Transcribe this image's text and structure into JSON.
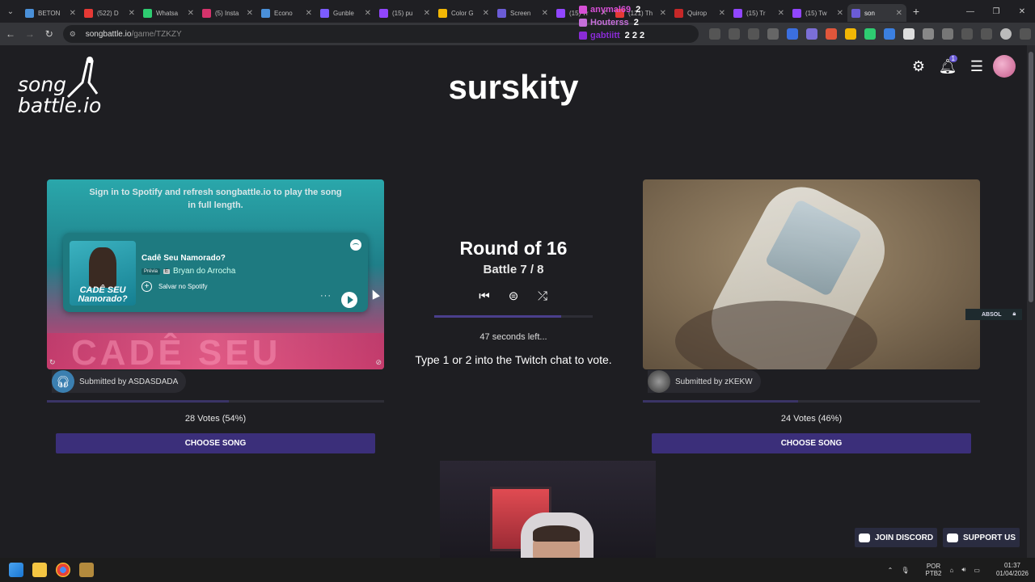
{
  "browser": {
    "tabs": [
      {
        "label": "BETON",
        "color": "#4a90d9"
      },
      {
        "label": "(522) D",
        "color": "#e53935"
      },
      {
        "label": "Whatsa",
        "color": "#2ecc71"
      },
      {
        "label": "(5) Insta",
        "color": "#d6336c"
      },
      {
        "label": "Econo",
        "color": "#4a90d9"
      },
      {
        "label": "Gunble",
        "color": "#7c5cff"
      },
      {
        "label": "(15) pu",
        "color": "#9146ff"
      },
      {
        "label": "Color G",
        "color": "#f2b705"
      },
      {
        "label": "Screen",
        "color": "#6b5cd6"
      },
      {
        "label": "(15) Tr",
        "color": "#9146ff"
      },
      {
        "label": "(121) Th",
        "color": "#e53935"
      },
      {
        "label": "Quirop",
        "color": "#c62828"
      },
      {
        "label": "(15) Tr",
        "color": "#9146ff"
      },
      {
        "label": "(15) Tw",
        "color": "#9146ff"
      },
      {
        "label": "son",
        "color": "#6b5cd6",
        "active": true
      }
    ],
    "url_host": "songbattle.io",
    "url_path": "/game/TZKZY"
  },
  "chat_overlay": [
    {
      "user": "anymal69",
      "msg": "2",
      "color": "#d64fd6"
    },
    {
      "user": "Houterss",
      "msg": "2",
      "color": "#c56fd9"
    },
    {
      "user": "gabtiitt",
      "msg": "2 2 2",
      "color": "#8a2bd6"
    }
  ],
  "header": {
    "logo_line1": "song",
    "logo_line2": "battle.io",
    "title": "surskity",
    "notification_count": "1"
  },
  "left_card": {
    "signin_message": "Sign in to Spotify and refresh songbattle.io to play the song in full length.",
    "embed_title": "Cadê Seu Namorado?",
    "preview_label": "Prévia",
    "explicit_label": "E",
    "artist": "Bryan do Arrocha",
    "save_label": "Salvar no Spotify",
    "cover_text": "CADÊ SEU Namorado?",
    "blur_text": "CADÊ SEU",
    "submitted_by": "Submitted by ASDASDADA",
    "votes_text": "28 Votes (54%)",
    "vote_fraction": 0.54,
    "choose_label": "CHOOSE SONG"
  },
  "right_card": {
    "submitted_by": "Submitted by zKEKW",
    "votes_text": "24 Votes (46%)",
    "vote_fraction": 0.46,
    "choose_label": "CHOOSE SONG",
    "tag": "ABSOL"
  },
  "center": {
    "round_title": "Round of 16",
    "battle_label": "Battle 7 / 8",
    "timer_progress": 0.8,
    "time_left": "47 seconds left...",
    "vote_instruction": "Type 1 or 2 into the Twitch chat to vote."
  },
  "footer_buttons": {
    "discord": "JOIN DISCORD",
    "support": "SUPPORT US"
  },
  "taskbar": {
    "lang_line1": "POR",
    "lang_line2": "PTB2",
    "time": "01:37",
    "date": "01/04/2026"
  }
}
